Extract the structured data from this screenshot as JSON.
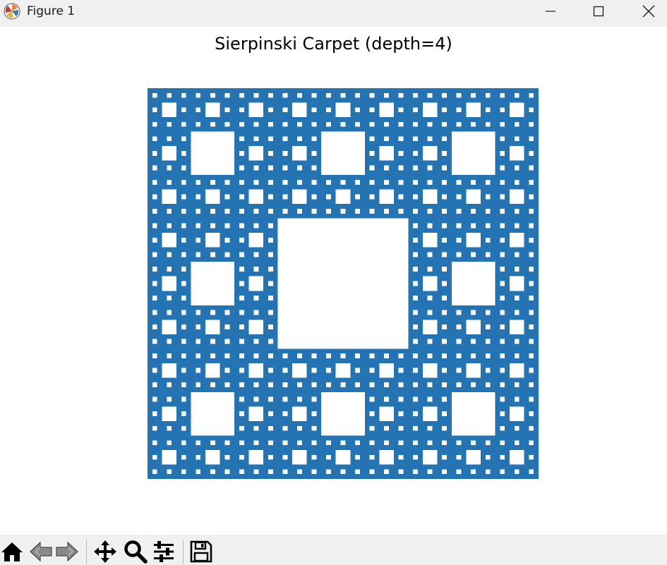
{
  "window": {
    "title": "Figure 1",
    "app_icon": "matplotlib-logo-icon",
    "controls": [
      "minimize-icon",
      "maximize-icon",
      "close-icon"
    ]
  },
  "figure": {
    "title": "Sierpinski Carpet (depth=4)",
    "depth": 4,
    "fill_color": "#2474b4",
    "hole_color": "#ffffff",
    "axes_visible": false
  },
  "toolbar": {
    "tools": [
      "home-icon",
      "back-arrow-icon",
      "forward-arrow-icon",
      "pan-move-icon",
      "zoom-magnifier-icon",
      "configure-subplots-icon",
      "save-floppy-icon"
    ]
  }
}
